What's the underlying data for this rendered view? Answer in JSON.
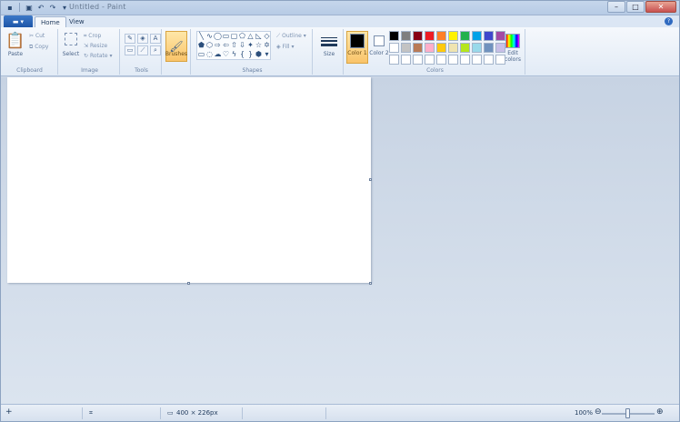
{
  "window": {
    "title": "Untitled - Paint",
    "controls": {
      "minimize": "–",
      "maximize": "□",
      "close": "✕"
    }
  },
  "quick_access": {
    "save_icon": "save-icon",
    "undo_icon": "undo-icon",
    "redo_icon": "redo-icon"
  },
  "tabs": {
    "app_menu": "▾",
    "home": "Home",
    "view": "View"
  },
  "ribbon": {
    "clipboard": {
      "label": "Clipboard",
      "paste": "Paste",
      "cut": "Cut",
      "copy": "Copy"
    },
    "image": {
      "label": "Image",
      "select": "Select",
      "crop": "Crop",
      "resize": "Resize",
      "rotate": "Rotate ▾"
    },
    "tools": {
      "label": "Tools"
    },
    "brushes": {
      "label": "Brushes"
    },
    "shapes": {
      "label": "Shapes",
      "outline": "Outline ▾",
      "fill": "Fill ▾"
    },
    "size": {
      "label": "Size"
    },
    "colors": {
      "label": "Colors",
      "color1": "Color 1",
      "color2": "Color 2",
      "edit": "Edit colors",
      "color1_value": "#000000",
      "color2_value": "#ffffff",
      "palette": [
        "#000000",
        "#7f7f7f",
        "#880015",
        "#ed1c24",
        "#ff7f27",
        "#fff200",
        "#22b14c",
        "#00a2e8",
        "#3f48cc",
        "#a349a4",
        "#ffffff",
        "#c3c3c3",
        "#b97a57",
        "#ffaec9",
        "#ffc90e",
        "#efe4b0",
        "#b5e61d",
        "#99d9ea",
        "#7092be",
        "#c8bfe7",
        "#ffffff",
        "#ffffff",
        "#ffffff",
        "#ffffff",
        "#ffffff",
        "#ffffff",
        "#ffffff",
        "#ffffff",
        "#ffffff",
        "#ffffff"
      ]
    }
  },
  "status": {
    "size": "400 × 226px",
    "zoom": "100%",
    "zoom_fraction": 0.5,
    "zoom_out": "⊖",
    "zoom_in": "⊕"
  }
}
